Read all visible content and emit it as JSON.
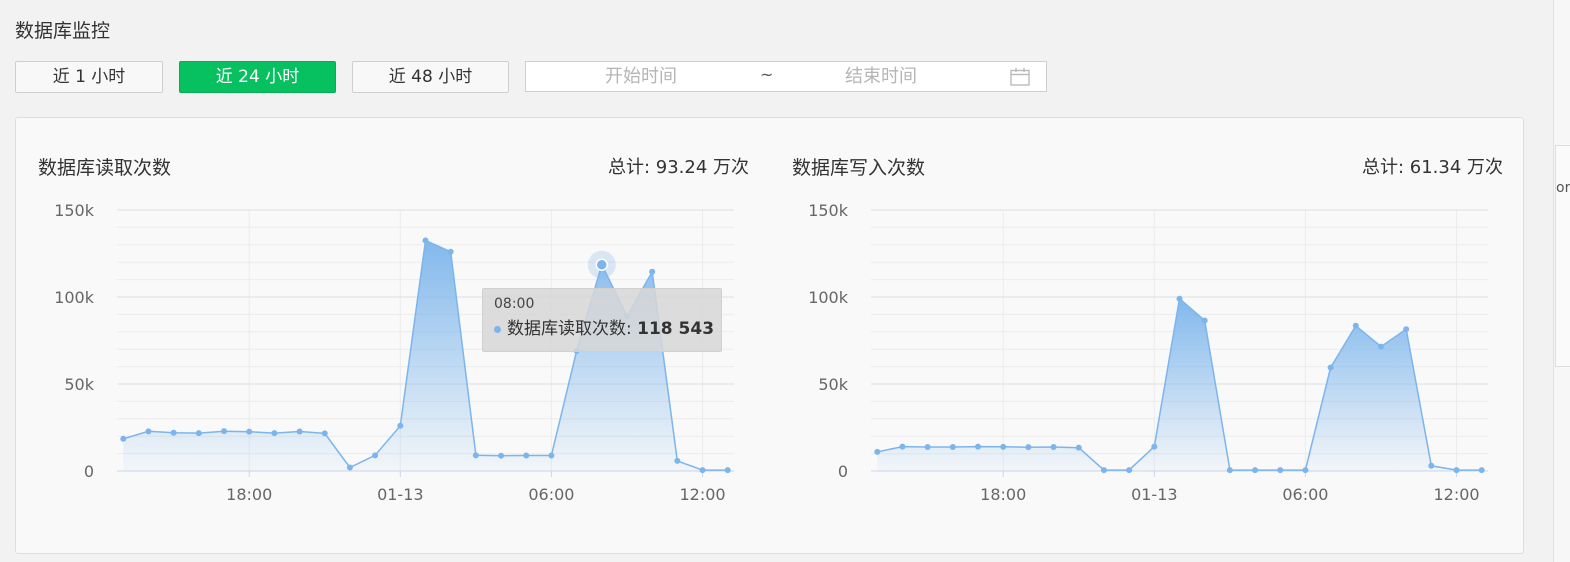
{
  "page": {
    "title": "数据库监控"
  },
  "toolbar": {
    "ranges": [
      {
        "label": "近 1 小时",
        "active": false
      },
      {
        "label": "近 24 小时",
        "active": true
      },
      {
        "label": "近 48 小时",
        "active": false
      }
    ],
    "date_range": {
      "start_placeholder": "开始时间",
      "separator": "~",
      "end_placeholder": "结束时间"
    },
    "calendar_icon": "calendar-icon"
  },
  "scroll_fragment": "or",
  "colors": {
    "accent": "#07c160",
    "series": "#7cb5ec",
    "grid": "#e6e6e6",
    "axis": "#ccd6eb"
  },
  "chart_data": [
    {
      "type": "area",
      "title": "数据库读取次数",
      "total_text": "总计: 93.24 万次",
      "series_name": "数据库读取次数",
      "x_ticks": [
        "18:00",
        "01-13",
        "06:00",
        "12:00"
      ],
      "x_tick_hours": [
        18,
        24,
        30,
        36
      ],
      "y_ticks": [
        "0",
        "50k",
        "100k",
        "150k"
      ],
      "y_tick_values": [
        0,
        50000,
        100000,
        150000
      ],
      "ylim": [
        0,
        150000
      ],
      "x_hours": [
        13,
        14,
        15,
        16,
        17,
        18,
        19,
        20,
        21,
        22,
        23,
        24,
        25,
        26,
        27,
        28,
        29,
        30,
        31,
        32,
        33,
        34,
        35,
        36,
        37
      ],
      "values": [
        18500,
        22800,
        22000,
        21800,
        22900,
        22600,
        21800,
        22700,
        21600,
        2000,
        9000,
        26000,
        132500,
        126000,
        9000,
        8800,
        8900,
        8900,
        69000,
        118543,
        89000,
        114500,
        5800,
        500,
        500
      ],
      "grid": true,
      "legend": "none",
      "tooltip": {
        "x": "08:00",
        "series": "数据库读取次数",
        "value": "118 543",
        "index": 19
      }
    },
    {
      "type": "area",
      "title": "数据库写入次数",
      "total_text": "总计: 61.34 万次",
      "series_name": "数据库写入次数",
      "x_ticks": [
        "18:00",
        "01-13",
        "06:00",
        "12:00"
      ],
      "x_tick_hours": [
        18,
        24,
        30,
        36
      ],
      "y_ticks": [
        "0",
        "50k",
        "100k",
        "150k"
      ],
      "y_tick_values": [
        0,
        50000,
        100000,
        150000
      ],
      "ylim": [
        0,
        150000
      ],
      "x_hours": [
        13,
        14,
        15,
        16,
        17,
        18,
        19,
        20,
        21,
        22,
        23,
        24,
        25,
        26,
        27,
        28,
        29,
        30,
        31,
        32,
        33,
        34,
        35,
        36,
        37
      ],
      "values": [
        11000,
        14000,
        13800,
        13800,
        14000,
        13900,
        13700,
        13800,
        13400,
        500,
        500,
        14000,
        99000,
        86500,
        500,
        500,
        500,
        500,
        59500,
        83500,
        71500,
        81500,
        3000,
        500,
        500
      ],
      "grid": true,
      "legend": "none"
    }
  ]
}
